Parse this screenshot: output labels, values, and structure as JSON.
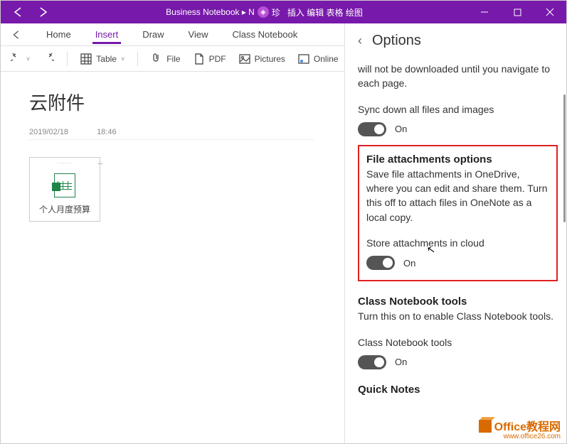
{
  "titlebar": {
    "breadcrumb": "Business Notebook ▸ N",
    "badge": "珍",
    "cn_menu": "插入  编辑  表格  绘图"
  },
  "tabs": {
    "home": "Home",
    "insert": "Insert",
    "draw": "Draw",
    "view": "View",
    "class": "Class Notebook"
  },
  "ribbon": {
    "table": "Table",
    "file": "File",
    "pdf": "PDF",
    "pictures": "Pictures",
    "online": "Online"
  },
  "page": {
    "title": "云附件",
    "date": "2019/02/18",
    "time": "18:46",
    "attachment_name": "个人月度预算"
  },
  "options": {
    "header": "Options",
    "navigate_partial": "will not be downloaded until you navigate to each page.",
    "sync_label": "Sync down all files and images",
    "sync_state": "On",
    "fao_title": "File attachments options",
    "fao_desc": "Save file attachments in OneDrive, where you can edit and share them. Turn this off to attach files in OneNote as a local copy.",
    "store_label": "Store attachments in cloud",
    "store_state": "On",
    "cnb_title": "Class Notebook tools",
    "cnb_desc": "Turn this on to enable Class Notebook tools.",
    "cnb_label": "Class Notebook tools",
    "cnb_state": "On",
    "quick_title": "Quick Notes"
  },
  "watermark": {
    "brand": "Office教程网",
    "url": "www.office26.com"
  }
}
